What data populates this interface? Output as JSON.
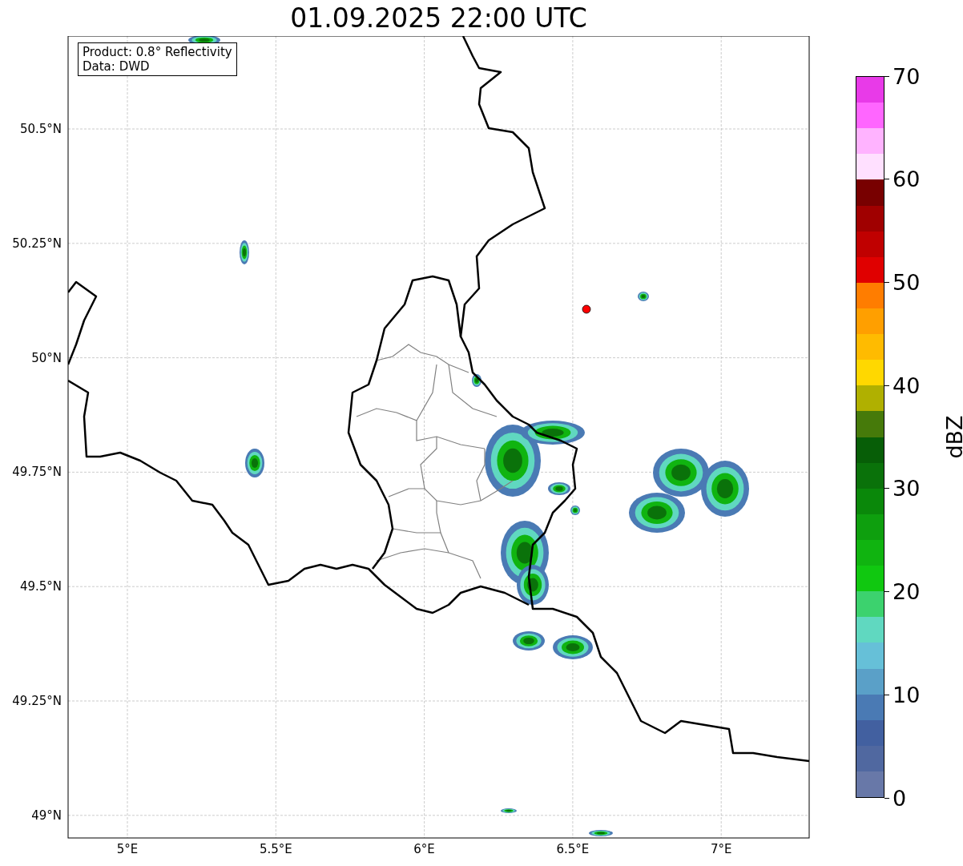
{
  "figure": {
    "title": "01.09.2025 22:00 UTC",
    "info_box": [
      "Product: 0.8° Reflectivity",
      "Data: DWD"
    ],
    "map": {
      "xticks": [
        "5°E",
        "5.5°E",
        "6°E",
        "6.5°E",
        "7°E"
      ],
      "yticks": [
        "50.5°N",
        "50.25°N",
        "50°N",
        "49.75°N",
        "49.5°N",
        "49.25°N",
        "49°N"
      ],
      "marker": {
        "color": "#ff0000"
      }
    },
    "colorbar": {
      "label": "dBZ",
      "ticks": [
        "70",
        "60",
        "50",
        "40",
        "30",
        "20",
        "10",
        "0"
      ],
      "segments": [
        {
          "color": "#e83ae8"
        },
        {
          "color": "#ff66ff"
        },
        {
          "color": "#ffb3ff"
        },
        {
          "color": "#ffe0ff"
        },
        {
          "color": "#780000"
        },
        {
          "color": "#a00000"
        },
        {
          "color": "#c00000"
        },
        {
          "color": "#e00000"
        },
        {
          "color": "#ff7d00"
        },
        {
          "color": "#ff9f00"
        },
        {
          "color": "#ffbb00"
        },
        {
          "color": "#ffd800"
        },
        {
          "color": "#b0b000"
        },
        {
          "color": "#467a0a"
        },
        {
          "color": "#075e07"
        },
        {
          "color": "#0a720a"
        },
        {
          "color": "#0a880a"
        },
        {
          "color": "#0e9f0e"
        },
        {
          "color": "#10b410"
        },
        {
          "color": "#10c810"
        },
        {
          "color": "#3cd26e"
        },
        {
          "color": "#60d8c0"
        },
        {
          "color": "#66c0d8"
        },
        {
          "color": "#5aa0c8"
        },
        {
          "color": "#4a7ab4"
        },
        {
          "color": "#4260a0"
        },
        {
          "color": "#5068a0"
        },
        {
          "color": "#6878a8"
        }
      ]
    }
  }
}
